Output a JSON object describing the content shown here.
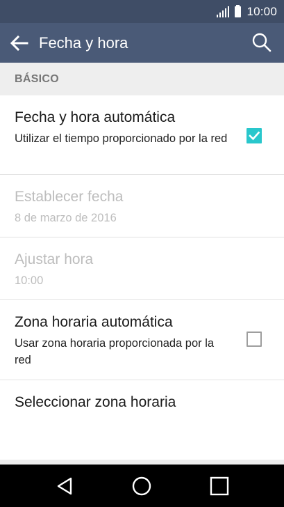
{
  "status_bar": {
    "time": "10:00",
    "signal_icon": "signal-icon",
    "battery_icon": "battery-icon"
  },
  "app_bar": {
    "title": "Fecha y hora",
    "back_icon": "arrow-left-icon",
    "search_icon": "search-icon"
  },
  "section": {
    "header": "BÁSICO"
  },
  "preferences": [
    {
      "title": "Fecha y hora automática",
      "summary": "Utilizar el tiempo proporcionado por la red",
      "checkbox": true,
      "enabled": true
    },
    {
      "title": "Establecer fecha",
      "summary": "8 de marzo de 2016",
      "enabled": false
    },
    {
      "title": "Ajustar hora",
      "summary": "10:00",
      "enabled": false
    },
    {
      "title": "Zona horaria automática",
      "summary": "Usar zona horaria proporcionada por la red",
      "checkbox": false,
      "enabled": true
    },
    {
      "title": "Seleccionar zona horaria",
      "enabled": true
    }
  ],
  "nav_bar": {
    "back_icon": "triangle-back-icon",
    "home_icon": "circle-home-icon",
    "recents_icon": "square-recents-icon"
  },
  "colors": {
    "status_bar": "#3f4d66",
    "app_bar": "#4a5a77",
    "accent": "#29c7cc",
    "section_bg": "#eeeeee",
    "disabled_text": "#bdbdbd"
  }
}
